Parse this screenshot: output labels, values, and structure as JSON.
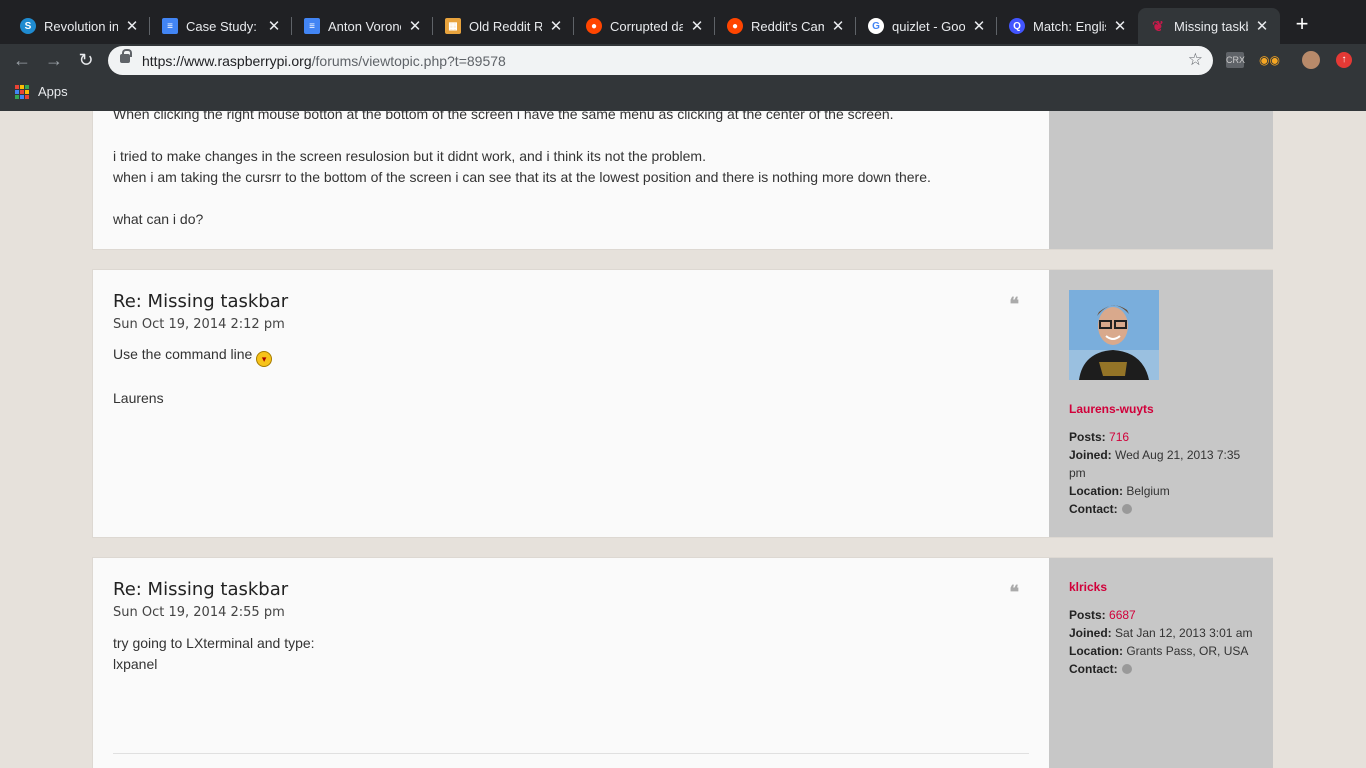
{
  "browser": {
    "tabs": [
      {
        "title": "Revolution in",
        "fav": "S",
        "fav_color": "#1f8bd0"
      },
      {
        "title": "Case Study: N",
        "fav": "≡",
        "fav_color": "#4285f4"
      },
      {
        "title": "Anton Vorono",
        "fav": "≡",
        "fav_color": "#4285f4"
      },
      {
        "title": "Old Reddit Re",
        "fav": "▦",
        "fav_color": "#e8a33d"
      },
      {
        "title": "Corrupted da",
        "fav": "●",
        "fav_color": "#ff4500"
      },
      {
        "title": "Reddit's Cam",
        "fav": "●",
        "fav_color": "#ff4500"
      },
      {
        "title": "quizlet - Goo",
        "fav": "G",
        "fav_color": "#ffffff"
      },
      {
        "title": "Match: Englis",
        "fav": "Q",
        "fav_color": "#4255ff"
      },
      {
        "title": "Missing taskb",
        "fav": "❦",
        "fav_color": "#c51a4a"
      }
    ],
    "url_host": "https://www.raspberrypi.org",
    "url_path": "/forums/viewtopic.php?t=89578",
    "bookmarks_label": "Apps",
    "extensions": [
      "CRX"
    ]
  },
  "posts": [
    {
      "lines": [
        "When clicking the right mouse botton at the bottom of the screen i have the same menu as clicking at the center of the screen.",
        "",
        "i tried to make changes in the screen resulosion but it didnt work, and i think its not the problem.",
        "when i am taking the cursrr to the bottom of the screen i can see that its at the lowest position and there is nothing more down there.",
        "",
        "what can i do?"
      ]
    },
    {
      "title": "Re: Missing taskbar",
      "date": "Sun Oct 19, 2014 2:12 pm",
      "lines": [
        "Use the command line",
        "",
        "Laurens"
      ],
      "author": "Laurens-wuyts",
      "posts_label": "Posts:",
      "posts_count": "716",
      "joined_label": "Joined:",
      "joined": "Wed Aug 21, 2013 7:35 pm",
      "location_label": "Location:",
      "location": "Belgium",
      "contact_label": "Contact:"
    },
    {
      "title": "Re: Missing taskbar",
      "date": "Sun Oct 19, 2014 2:55 pm",
      "lines": [
        "try going to LXterminal and type:",
        "lxpanel"
      ],
      "author": "klricks",
      "posts_label": "Posts:",
      "posts_count": "6687",
      "joined_label": "Joined:",
      "joined": "Sat Jan 12, 2013 3:01 am",
      "location_label": "Location:",
      "location": "Grants Pass, OR, USA",
      "contact_label": "Contact:"
    }
  ],
  "colors": {
    "accent": "#d1003a",
    "sidebar": "#c7c7c7",
    "page_bg": "#e6e1db"
  }
}
